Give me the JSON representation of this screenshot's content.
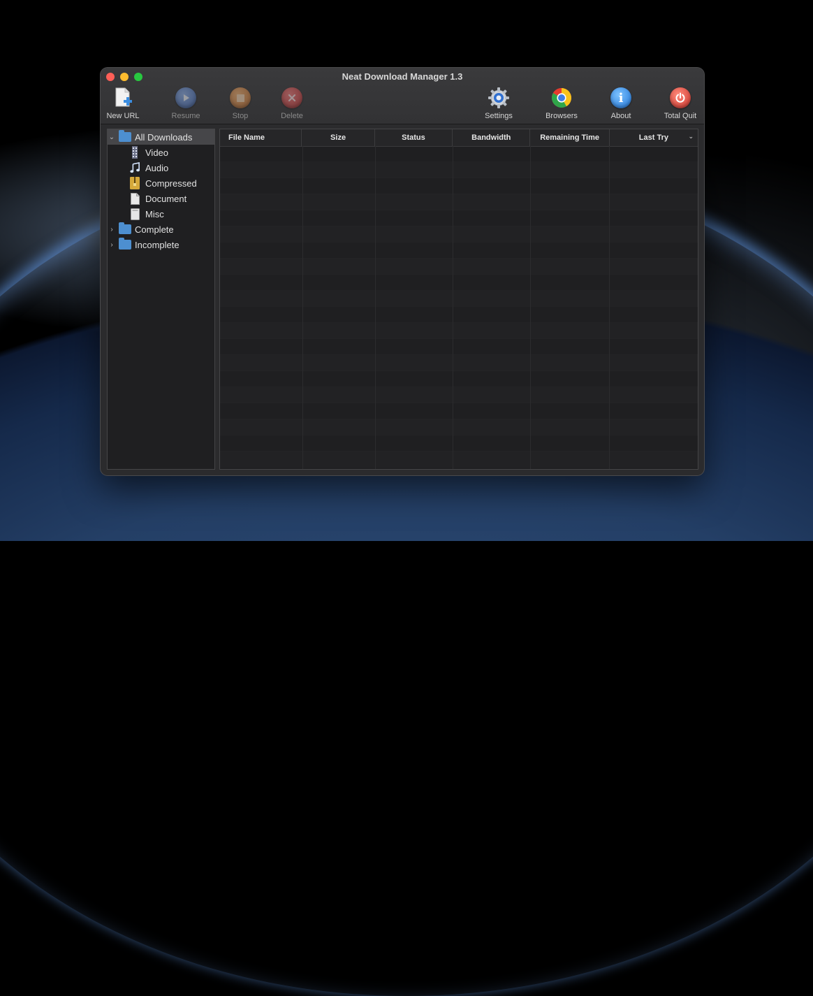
{
  "window": {
    "title": "Neat Download Manager 1.3"
  },
  "toolbar": {
    "new_url": "New URL",
    "resume": "Resume",
    "stop": "Stop",
    "delete": "Delete",
    "settings": "Settings",
    "browsers": "Browsers",
    "about": "About",
    "total_quit": "Total Quit"
  },
  "sidebar": {
    "items": [
      {
        "label": "All Downloads",
        "icon": "folder-icon",
        "expanded": true,
        "selected": true
      },
      {
        "label": "Video",
        "icon": "video-file-icon"
      },
      {
        "label": "Audio",
        "icon": "music-note-icon"
      },
      {
        "label": "Compressed",
        "icon": "archive-icon"
      },
      {
        "label": "Document",
        "icon": "document-icon"
      },
      {
        "label": "Misc",
        "icon": "misc-file-icon"
      },
      {
        "label": "Complete",
        "icon": "folder-icon",
        "expanded": false
      },
      {
        "label": "Incomplete",
        "icon": "folder-icon",
        "expanded": false
      }
    ]
  },
  "table": {
    "columns": [
      "File Name",
      "Size",
      "Status",
      "Bandwidth",
      "Remaining Time",
      "Last Try"
    ],
    "sort_column": "Last Try",
    "sort_direction": "descending",
    "rows": []
  },
  "colors": {
    "accent_folder": "#4d8fd0",
    "close": "#fe5f57",
    "minimize": "#febc2e",
    "zoom": "#28c840"
  }
}
